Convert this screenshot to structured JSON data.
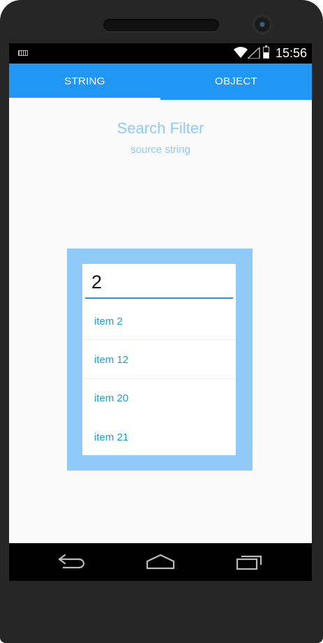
{
  "status_bar": {
    "time": "15:56",
    "icons": [
      "keyboard-icon",
      "wifi-icon",
      "signal-icon",
      "battery-icon"
    ]
  },
  "tabs": [
    {
      "label": "STRING",
      "active": true
    },
    {
      "label": "OBJECT",
      "active": false
    }
  ],
  "header": {
    "title": "Search Filter",
    "subtitle": "source string"
  },
  "search": {
    "value": "2"
  },
  "results": [
    "item 2",
    "item 12",
    "item 20",
    "item 21"
  ],
  "nav_bar": {
    "icons": [
      "back-icon",
      "home-icon",
      "recents-icon"
    ]
  },
  "colors": {
    "accent": "#2196f3",
    "panel": "#90caf9",
    "list_text": "#1e9fd6",
    "background": "#fafafa"
  }
}
